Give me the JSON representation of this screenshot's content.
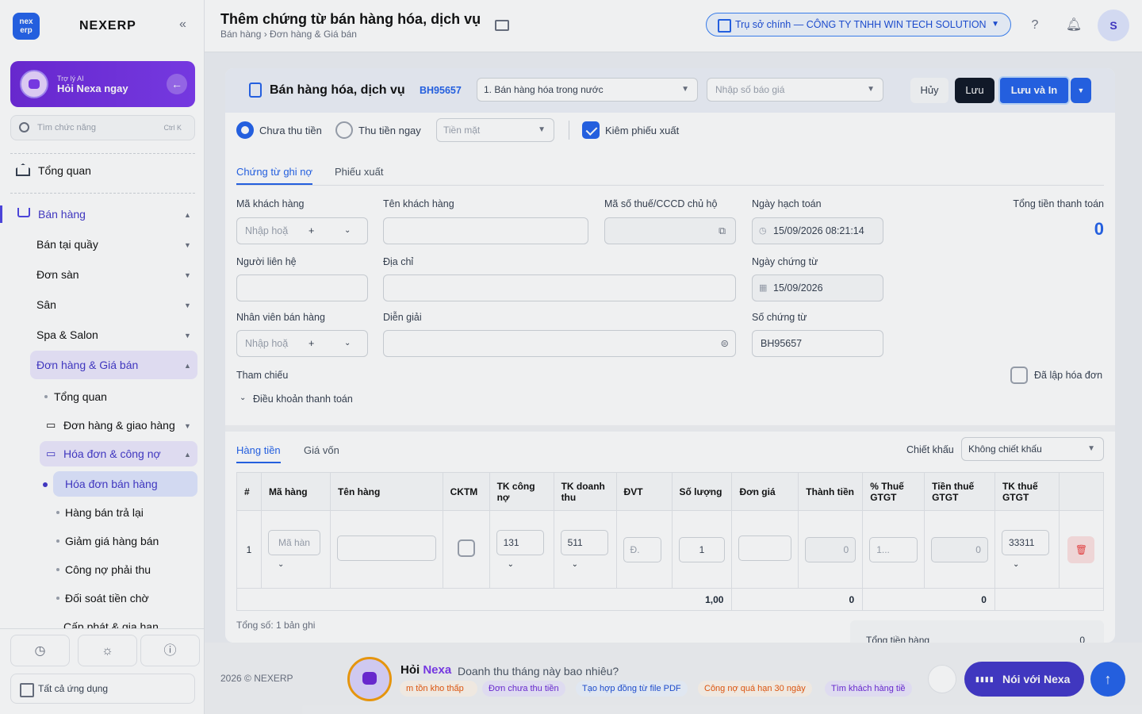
{
  "app": {
    "brand": "NEXERP",
    "logo_text": "nex erp"
  },
  "sidebar": {
    "ai_card": {
      "subtitle": "Trợ lý AI",
      "title": "Hỏi Nexa ngay"
    },
    "search": {
      "placeholder": "Tìm chức năng",
      "shortcut": "Ctrl K"
    },
    "items": {
      "overview": "Tổng quan",
      "sales": "Bán hàng",
      "counter": "Bán tại quầy",
      "marketplace": "Đơn sàn",
      "court": "Sân",
      "spa": "Spa & Salon",
      "orders_prices": "Đơn hàng & Giá bán",
      "sub_overview": "Tổng quan",
      "orders_delivery": "Đơn hàng & giao hàng",
      "invoices_debt": "Hóa đơn & công nợ",
      "sales_invoice": "Hóa đơn bán hàng",
      "returns": "Hàng bán trả lại",
      "discounts": "Giảm giá hàng bán",
      "receivables": "Công nợ phải thu",
      "reconcile": "Đối soát tiền chờ",
      "provision": "Cấp phát & gia hạn"
    },
    "all_apps": "Tất cả ứng dụng"
  },
  "header": {
    "title": "Thêm chứng từ bán hàng hóa, dịch vụ",
    "breadcrumb": "Bán hàng › Đơn hàng & Giá bán",
    "company": "Trụ sở chính — CÔNG TY TNHH WIN TECH SOLUTION",
    "avatar": "S"
  },
  "form": {
    "title": "Bán hàng hóa, dịch vụ",
    "doc_no": "BH95657",
    "sale_type": "1. Bán hàng hóa trong nước",
    "quote_placeholder": "Nhập số báo giá",
    "cancel": "Hủy",
    "save": "Lưu",
    "save_print": "Lưu và In",
    "unpaid": "Chưa thu tiền",
    "paid_now": "Thu tiền ngay",
    "payment_method": "Tiền mặt",
    "with_export": "Kiêm phiếu xuất",
    "tabs": {
      "debt_doc": "Chứng từ ghi nợ",
      "export_slip": "Phiếu xuất"
    },
    "labels": {
      "customer_code": "Mã khách hàng",
      "customer_name": "Tên khách hàng",
      "tax_id": "Mã số thuế/CCCD chủ hộ",
      "posting_date": "Ngày hạch toán",
      "total_payment": "Tổng tiền thanh toán",
      "contact": "Người liên hệ",
      "address": "Địa chỉ",
      "doc_date": "Ngày chứng từ",
      "salesperson": "Nhân viên bán hàng",
      "description": "Diễn giải",
      "doc_number": "Số chứng từ",
      "reference": "Tham chiếu",
      "invoiced": "Đã lập hóa đơn",
      "payment_terms": "Điều khoản thanh toán"
    },
    "values": {
      "code_placeholder": "Nhập hoặ",
      "posting_date": "15/09/2026 08:21:14",
      "total_payment": "0",
      "doc_date": "15/09/2026",
      "doc_number": "BH95657"
    }
  },
  "grid": {
    "tabs": {
      "goods": "Hàng tiền",
      "cost": "Giá vốn"
    },
    "discount_label": "Chiết khấu",
    "discount_value": "Không chiết khấu",
    "columns": [
      "#",
      "Mã hàng",
      "Tên hàng",
      "CKTM",
      "TK công nợ",
      "TK doanh thu",
      "ĐVT",
      "Số lượng",
      "Đơn giá",
      "Thành tiền",
      "% Thuế GTGT",
      "Tiền thuế GTGT",
      "TK thuế GTGT",
      ""
    ],
    "row": {
      "index": "1",
      "code_placeholder": "Mã hàn",
      "debt_acc": "131",
      "rev_acc": "511",
      "unit": "Đ.",
      "qty": "1",
      "amount": "0",
      "vat_pct": "1...",
      "vat_amount": "0",
      "vat_acc": "33311"
    },
    "totals": {
      "qty": "1,00",
      "amount": "0",
      "vat": "0"
    },
    "record_count": "Tổng số: 1 bản ghi",
    "goods_total_label": "Tổng tiền hàng",
    "goods_total_value": "0"
  },
  "footer": {
    "copyright": "2026 © NEXERP",
    "ask": "Hỏi",
    "ask_brand": "Nexa",
    "question": "Doanh thu tháng này bao nhiêu?",
    "chips": [
      "m tồn kho thấp",
      "Đơn chưa thu tiền",
      "Tạo hợp đồng từ file PDF",
      "Công nợ quá hạn 30 ngày",
      "Tìm khách hàng tiề"
    ],
    "talk": "Nói với Nexa"
  }
}
